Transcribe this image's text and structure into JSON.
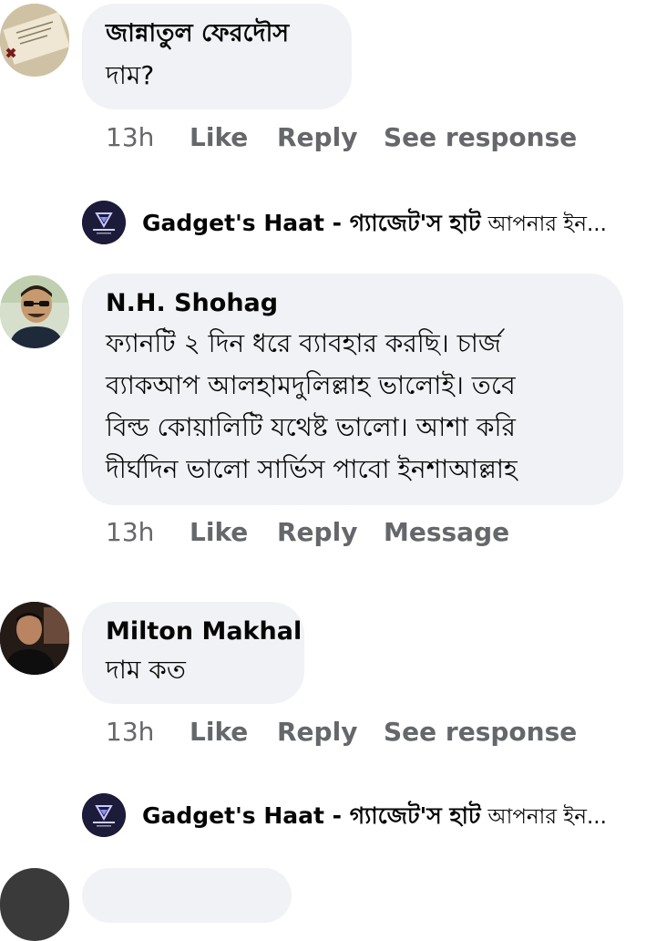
{
  "comments": [
    {
      "author": "জান্নাতুল ফেরদৌস",
      "lines": [
        "দাম?"
      ],
      "time": "13h",
      "like": "Like",
      "reply": "Reply",
      "extra": "See response"
    },
    {
      "author": "N.H. Shohag",
      "lines": [
        "ফ্যানটি ২ দিন ধরে ব্যাবহার করছি। চার্জ",
        "ব্যাকআপ আলহামদুলিল্লাহ ভালোই। তবে",
        "বিল্ড কোয়ালিটি যথেষ্ট ভালো। আশা করি",
        "দীর্ঘদিন ভালো সার্ভিস পাবো ইনশাআল্লাহ"
      ],
      "time": "13h",
      "like": "Like",
      "reply": "Reply",
      "extra": "Message"
    },
    {
      "author": "Milton Makhal",
      "lines": [
        "দাম কত"
      ],
      "time": "13h",
      "like": "Like",
      "reply": "Reply",
      "extra": "See response"
    }
  ],
  "page_replies": [
    {
      "page_name": "Gadget's Haat - গ্যাজেট'স হাট",
      "snippet": "আপনার ইন..."
    },
    {
      "page_name": "Gadget's Haat - গ্যাজেট'স হাট",
      "snippet": "আপনার ইন..."
    }
  ],
  "icons": {
    "page_logo": "gadgets-haat-logo"
  },
  "colors": {
    "bubble": "#f0f2f5",
    "meta_text": "#65676b",
    "text": "#050505",
    "page_logo_bg": "#1c1b3a"
  }
}
